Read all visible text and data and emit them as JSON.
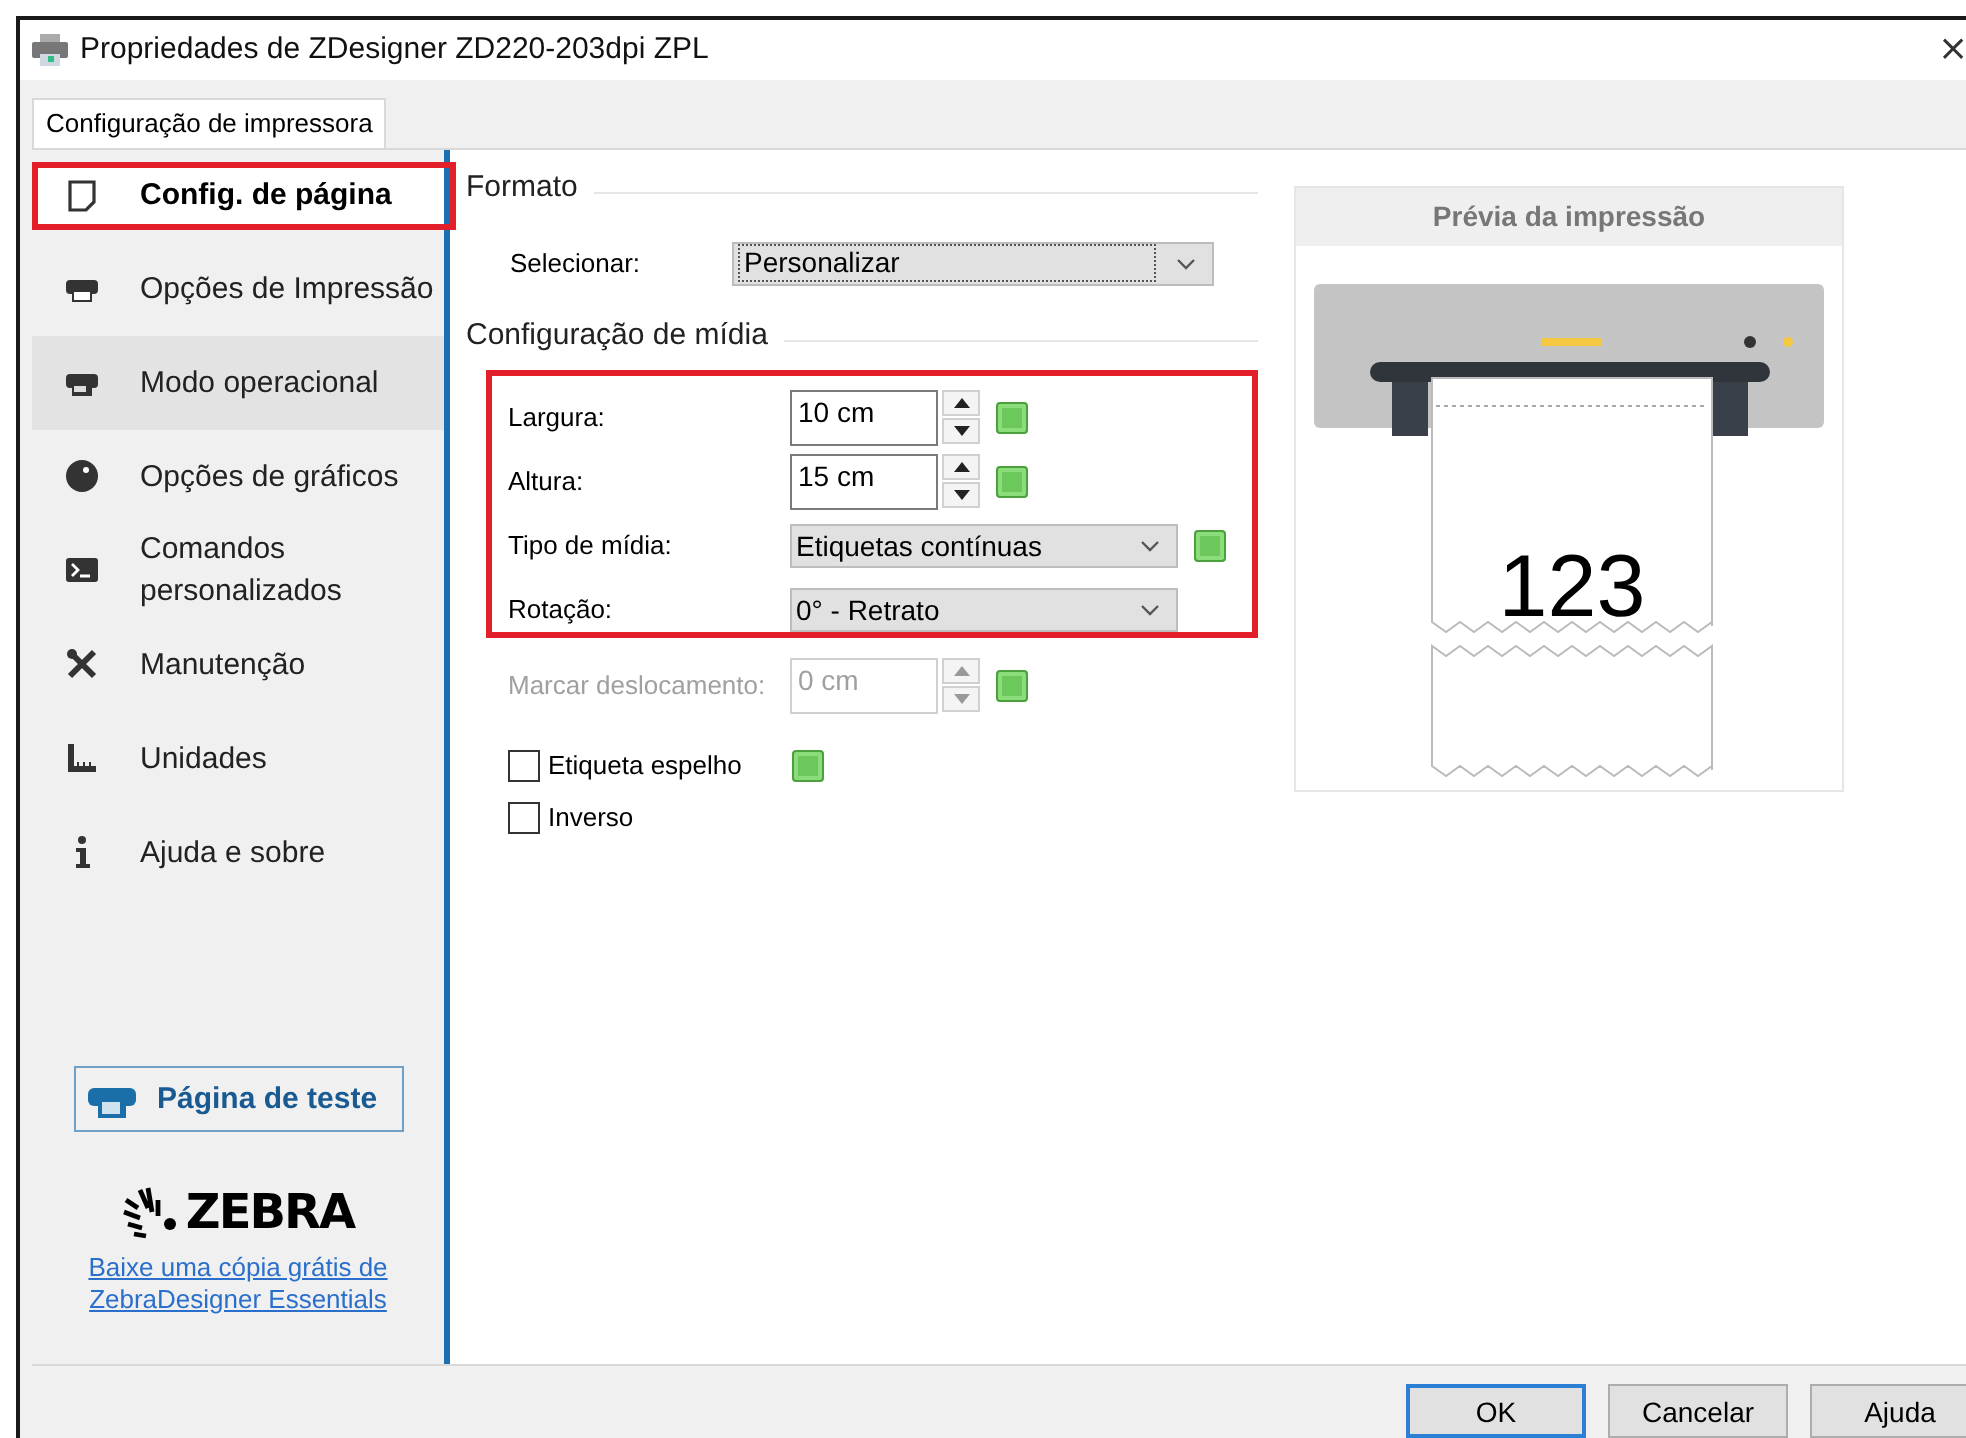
{
  "window": {
    "title": "Propriedades de ZDesigner ZD220-203dpi ZPL",
    "close": "×"
  },
  "tabs": [
    {
      "label": "Configuração de impressora",
      "selected": true
    }
  ],
  "sidebar": {
    "items": [
      {
        "label": "Config. de página",
        "selected": true,
        "hovered": false,
        "highlighted": true
      },
      {
        "label": "Opções de Impressão",
        "selected": false,
        "hovered": false,
        "highlighted": false
      },
      {
        "label": "Modo operacional",
        "selected": false,
        "hovered": true,
        "highlighted": false
      },
      {
        "label": "Opções de gráficos",
        "selected": false,
        "hovered": false,
        "highlighted": false
      },
      {
        "label": "Comandos personalizados",
        "selected": false,
        "hovered": false,
        "highlighted": false
      },
      {
        "label": "Manutenção",
        "selected": false,
        "hovered": false,
        "highlighted": false
      },
      {
        "label": "Unidades",
        "selected": false,
        "hovered": false,
        "highlighted": false
      },
      {
        "label": "Ajuda e sobre",
        "selected": false,
        "hovered": false,
        "highlighted": false
      }
    ],
    "test_button": "Página de teste",
    "brand": "ZEBRA",
    "link": "Baixe uma cópia grátis de ZebraDesigner Essentials"
  },
  "format": {
    "heading": "Formato",
    "label": "Selecionar:",
    "value": "Personalizar"
  },
  "media": {
    "heading": "Configuração de mídia",
    "highlighted": true,
    "rows": [
      {
        "kind": "spinner",
        "label": "Largura:",
        "value": "10 cm",
        "disabled": false,
        "indicator": true,
        "boxed": true
      },
      {
        "kind": "spinner",
        "label": "Altura:",
        "value": "15 cm",
        "disabled": false,
        "indicator": true,
        "boxed": true
      },
      {
        "kind": "dropdown",
        "label": "Tipo de mídia:",
        "value": "Etiquetas contínuas",
        "disabled": false,
        "indicator": true,
        "boxed": true
      },
      {
        "kind": "dropdown",
        "label": "Rotação:",
        "value": "0° - Retrato",
        "disabled": false,
        "indicator": false,
        "boxed": true
      },
      {
        "kind": "spinner",
        "label": "Marcar deslocamento:",
        "value": "0 cm",
        "disabled": true,
        "indicator": true,
        "boxed": false
      }
    ],
    "checks": [
      {
        "label": "Etiqueta espelho",
        "checked": false,
        "indicator": true
      },
      {
        "label": "Inverso",
        "checked": false,
        "indicator": false
      }
    ]
  },
  "preview": {
    "title": "Prévia da impressão",
    "sample_text": "123"
  },
  "buttons": [
    {
      "label": "OK",
      "default": true
    },
    {
      "label": "Cancelar",
      "default": false
    },
    {
      "label": "Ajuda",
      "default": false
    }
  ]
}
